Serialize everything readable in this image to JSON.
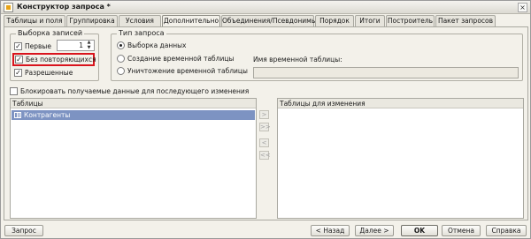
{
  "window": {
    "title": "Конструктор запроса *",
    "close_icon": "×"
  },
  "tabs": [
    {
      "label": "Таблицы и поля"
    },
    {
      "label": "Группировка"
    },
    {
      "label": "Условия"
    },
    {
      "label": "Дополнительно",
      "active": true
    },
    {
      "label": "Объединения/Псевдонимы"
    },
    {
      "label": "Порядок"
    },
    {
      "label": "Итоги"
    },
    {
      "label": "Построитель"
    },
    {
      "label": "Пакет запросов"
    }
  ],
  "selection": {
    "title": "Выборка записей",
    "first_label": "Первые",
    "first_checked": true,
    "first_value": "1",
    "distinct_label": "Без повторяющихся",
    "distinct_checked": true,
    "allowed_label": "Разрешенные",
    "allowed_checked": true
  },
  "query_type": {
    "title": "Тип запроса",
    "options": [
      {
        "label": "Выборка данных",
        "selected": true
      },
      {
        "label": "Создание временной таблицы",
        "selected": false
      },
      {
        "label": "Уничтожение временной таблицы",
        "selected": false
      }
    ],
    "temp_table_label": "Имя временной таблицы:",
    "temp_table_value": ""
  },
  "lock": {
    "label": "Блокировать получаемые данные для последующего изменения",
    "checked": false
  },
  "tables_panel": {
    "header": "Таблицы",
    "items": [
      "Контрагенты"
    ]
  },
  "change_panel": {
    "header": "Таблицы для изменения",
    "items": []
  },
  "move_buttons": {
    "add": ">",
    "add_all": ">>",
    "remove": "<",
    "remove_all": "<<"
  },
  "bottom": {
    "query_label": "Запрос",
    "back_label": "< Назад",
    "next_label": "Далее >",
    "ok_label": "OK",
    "cancel_label": "Отмена",
    "help_label": "Справка"
  },
  "colors": {
    "highlight": "#d9141d",
    "selection": "#7d93c2"
  }
}
